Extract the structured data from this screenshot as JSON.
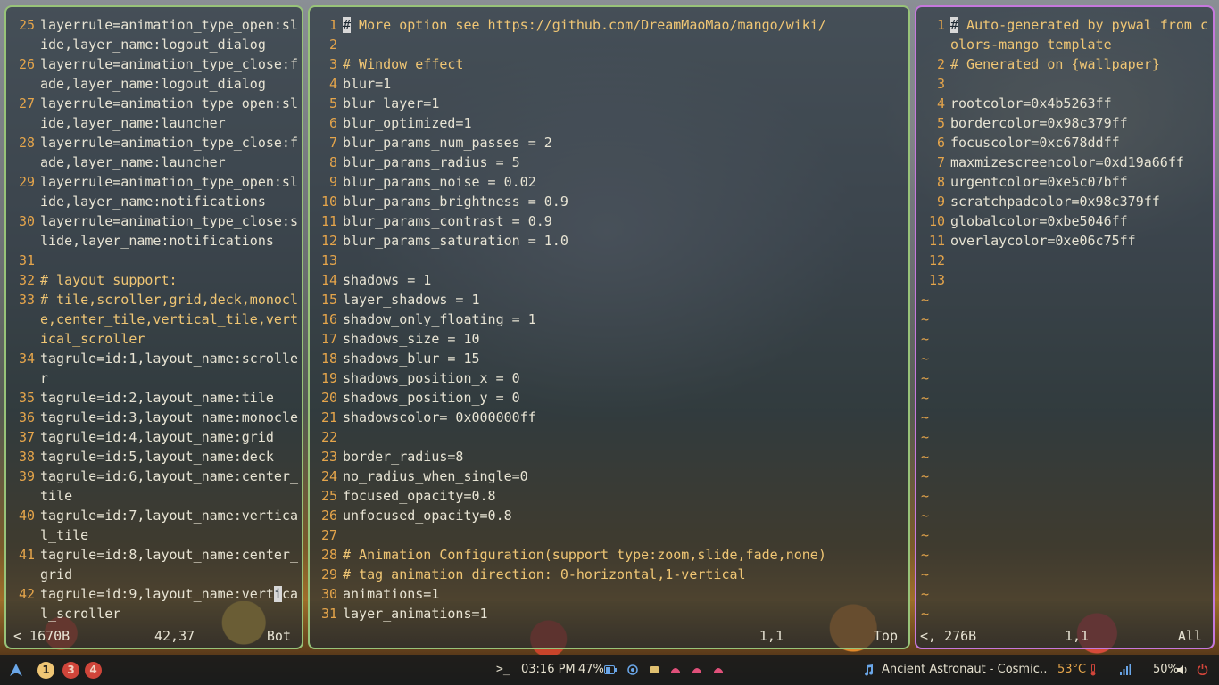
{
  "colors": {
    "accent_green": "#98c379",
    "accent_purple": "#c678dd",
    "line_number": "#e5a54b",
    "comment": "#f0c674",
    "temp_warn": "#e5a54b",
    "ws_active": "#f0c674",
    "ws_occupied": "#d0453a"
  },
  "left_pane": {
    "lines": [
      {
        "n": "25",
        "t": "layerrule=animation_type_open:slide,layer_name:logout_dialog"
      },
      {
        "n": "26",
        "t": "layerrule=animation_type_close:fade,layer_name:logout_dialog"
      },
      {
        "n": "27",
        "t": "layerrule=animation_type_open:slide,layer_name:launcher"
      },
      {
        "n": "28",
        "t": "layerrule=animation_type_close:fade,layer_name:launcher"
      },
      {
        "n": "29",
        "t": "layerrule=animation_type_open:slide,layer_name:notifications"
      },
      {
        "n": "30",
        "t": "layerrule=animation_type_close:slide,layer_name:notifications"
      },
      {
        "n": "31",
        "t": ""
      },
      {
        "n": "32",
        "t": "# layout support:"
      },
      {
        "n": "33",
        "t": "# tile,scroller,grid,deck,monocle,center_tile,vertical_tile,vertical_scroller"
      },
      {
        "n": "34",
        "t": "tagrule=id:1,layout_name:scroller"
      },
      {
        "n": "35",
        "t": "tagrule=id:2,layout_name:tile"
      },
      {
        "n": "36",
        "t": "tagrule=id:3,layout_name:monocle"
      },
      {
        "n": "37",
        "t": "tagrule=id:4,layout_name:grid"
      },
      {
        "n": "38",
        "t": "tagrule=id:5,layout_name:deck"
      },
      {
        "n": "39",
        "t": "tagrule=id:6,layout_name:center_tile"
      },
      {
        "n": "40",
        "t": "tagrule=id:7,layout_name:vertical_tile"
      },
      {
        "n": "41",
        "t": "tagrule=id:8,layout_name:center_grid"
      },
      {
        "n": "42",
        "t": "tagrule=id:9,layout_name:vertical_scroller"
      }
    ],
    "status_file": "< 1670B",
    "status_pos": "42,37",
    "status_scroll": "Bot"
  },
  "mid_pane": {
    "lines": [
      {
        "n": "1",
        "t": "# More option see https://github.com/DreamMaoMao/mango/wiki/"
      },
      {
        "n": "2",
        "t": ""
      },
      {
        "n": "3",
        "t": "# Window effect"
      },
      {
        "n": "4",
        "t": "blur=1"
      },
      {
        "n": "5",
        "t": "blur_layer=1"
      },
      {
        "n": "6",
        "t": "blur_optimized=1"
      },
      {
        "n": "7",
        "t": "blur_params_num_passes = 2"
      },
      {
        "n": "8",
        "t": "blur_params_radius = 5"
      },
      {
        "n": "9",
        "t": "blur_params_noise = 0.02"
      },
      {
        "n": "10",
        "t": "blur_params_brightness = 0.9"
      },
      {
        "n": "11",
        "t": "blur_params_contrast = 0.9"
      },
      {
        "n": "12",
        "t": "blur_params_saturation = 1.0"
      },
      {
        "n": "13",
        "t": ""
      },
      {
        "n": "14",
        "t": "shadows = 1"
      },
      {
        "n": "15",
        "t": "layer_shadows = 1"
      },
      {
        "n": "16",
        "t": "shadow_only_floating = 1"
      },
      {
        "n": "17",
        "t": "shadows_size = 10"
      },
      {
        "n": "18",
        "t": "shadows_blur = 15"
      },
      {
        "n": "19",
        "t": "shadows_position_x = 0"
      },
      {
        "n": "20",
        "t": "shadows_position_y = 0"
      },
      {
        "n": "21",
        "t": "shadowscolor= 0x000000ff"
      },
      {
        "n": "22",
        "t": ""
      },
      {
        "n": "23",
        "t": "border_radius=8"
      },
      {
        "n": "24",
        "t": "no_radius_when_single=0"
      },
      {
        "n": "25",
        "t": "focused_opacity=0.8"
      },
      {
        "n": "26",
        "t": "unfocused_opacity=0.8"
      },
      {
        "n": "27",
        "t": ""
      },
      {
        "n": "28",
        "t": "# Animation Configuration(support type:zoom,slide,fade,none)"
      },
      {
        "n": "29",
        "t": "# tag_animation_direction: 0-horizontal,1-vertical"
      },
      {
        "n": "30",
        "t": "animations=1"
      },
      {
        "n": "31",
        "t": "layer_animations=1"
      }
    ],
    "status_pos": "1,1",
    "status_scroll": "Top"
  },
  "right_pane": {
    "lines": [
      {
        "n": "1",
        "t": "# Auto-generated by pywal from colors-mango template"
      },
      {
        "n": "2",
        "t": "# Generated on {wallpaper}"
      },
      {
        "n": "3",
        "t": ""
      },
      {
        "n": "4",
        "t": "rootcolor=0x4b5263ff"
      },
      {
        "n": "5",
        "t": "bordercolor=0x98c379ff"
      },
      {
        "n": "6",
        "t": "focuscolor=0xc678ddff"
      },
      {
        "n": "7",
        "t": "maxmizescreencolor=0xd19a66ff"
      },
      {
        "n": "8",
        "t": "urgentcolor=0xe5c07bff"
      },
      {
        "n": "9",
        "t": "scratchpadcolor=0x98c379ff"
      },
      {
        "n": "10",
        "t": "globalcolor=0xbe5046ff"
      },
      {
        "n": "11",
        "t": "overlaycolor=0xe06c75ff"
      },
      {
        "n": "12",
        "t": ""
      },
      {
        "n": "13",
        "t": ""
      }
    ],
    "tilde": "~",
    "tilde_count": 17,
    "status_file": "<, 276B",
    "status_pos": "1,1",
    "status_scroll": "All"
  },
  "bar": {
    "workspaces": [
      "1",
      "3",
      "4"
    ],
    "terminal_icon": ">_",
    "clock": "03:16 PM",
    "battery": "47%",
    "music": "Ancient Astronaut - Cosmic…",
    "temperature": "53°C",
    "volume": "50%"
  }
}
